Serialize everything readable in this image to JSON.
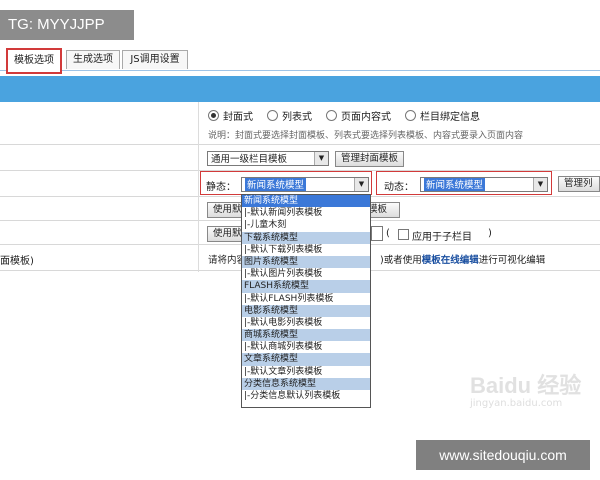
{
  "watermark_top": "TG: MYYJJPP",
  "watermark_bottom": "www.sitedouqiu.com",
  "baidu_watermark": "Baidu 经验",
  "baidu_sub": "jingyan.baidu.com",
  "tabs": [
    {
      "label": "模板选项",
      "active": true
    },
    {
      "label": "生成选项",
      "active": false
    },
    {
      "label": "JS调用设置",
      "active": false
    }
  ],
  "list_type": {
    "options": [
      "封面式",
      "列表式",
      "页面内容式",
      "栏目绑定信息"
    ],
    "selected_index": 0,
    "note": "说明：封面式要选择封面模板、列表式要选择列表模板、内容式要录入页面内容"
  },
  "cover_template": {
    "value": "通用一级栏目模板",
    "manage_button": "管理封面模板"
  },
  "model_row": {
    "static_label": "静态：",
    "static_value": "新闻系统模型",
    "dynamic_label": "动态：",
    "dynamic_value": "新闻系统模型",
    "manage_button": "管理列"
  },
  "row_default1": {
    "text": "使用默",
    "button": "模板"
  },
  "row_default2": {
    "text": "使用默",
    "apply_label": "应用于子栏目"
  },
  "left_help": "面模板)",
  "help_line": {
    "prefix": "请将内容",
    "middle": ")或者使用",
    "link": "模板在线编辑",
    "suffix": "进行可视化编辑"
  },
  "dropdown_items": [
    {
      "label": "新闻系统模型",
      "type": "selected"
    },
    {
      "label": "|-默认新闻列表模板",
      "type": "item"
    },
    {
      "label": "|-儿童木刻",
      "type": "item"
    },
    {
      "label": "下载系统模型",
      "type": "group"
    },
    {
      "label": "|-默认下载列表模板",
      "type": "item"
    },
    {
      "label": "图片系统模型",
      "type": "group"
    },
    {
      "label": "|-默认图片列表模板",
      "type": "item"
    },
    {
      "label": "FLASH系统模型",
      "type": "group"
    },
    {
      "label": "|-默认FLASH列表模板",
      "type": "item"
    },
    {
      "label": "电影系统模型",
      "type": "group"
    },
    {
      "label": "|-默认电影列表模板",
      "type": "item"
    },
    {
      "label": "商城系统模型",
      "type": "group"
    },
    {
      "label": "|-默认商城列表模板",
      "type": "item"
    },
    {
      "label": "文章系统模型",
      "type": "group"
    },
    {
      "label": "|-默认文章列表模板",
      "type": "item"
    },
    {
      "label": "分类信息系统模型",
      "type": "group"
    },
    {
      "label": "|-分类信息默认列表模板",
      "type": "item"
    }
  ],
  "colors": {
    "accent": "#4aa3df",
    "highlight": "#3b78d8",
    "group_bg": "#b9cfe8",
    "red": "#d23a3a"
  }
}
